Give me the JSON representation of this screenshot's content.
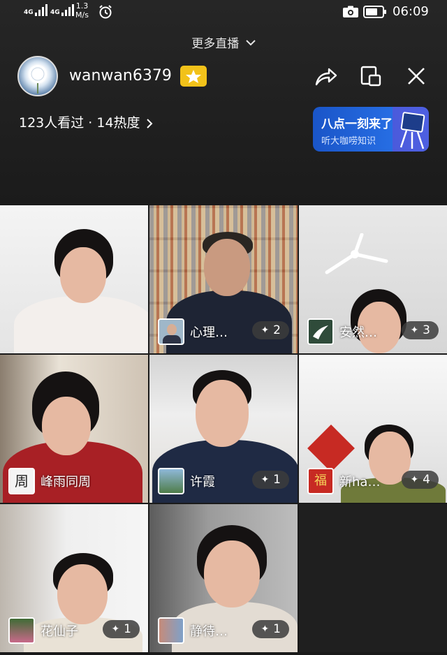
{
  "status_bar": {
    "sim1": "4G",
    "sim2": "4G",
    "net_speed_value": "1.3",
    "net_speed_unit": "M/s",
    "time": "06:09",
    "icons": [
      "signal-icon",
      "alarm-icon",
      "camera-icon",
      "battery-icon"
    ]
  },
  "header": {
    "more_live": "更多直播",
    "username": "wanwan6379",
    "stats": "123人看过 · 14热度",
    "icons": [
      "share-icon",
      "window-icon",
      "close-icon"
    ]
  },
  "promo": {
    "title": "八点一刻来了",
    "subtitle": "听大咖唠知识",
    "color": "#2563d9"
  },
  "participants": [
    {
      "name": "",
      "plus": ""
    },
    {
      "name": "心理…",
      "plus": "2"
    },
    {
      "name": "安然…",
      "plus": "3"
    },
    {
      "name": "峰雨同周",
      "plus": "",
      "avatar_text": "周"
    },
    {
      "name": "许霞",
      "plus": "1"
    },
    {
      "name": "新ha…",
      "plus": "4",
      "avatar_text": "福"
    },
    {
      "name": "花仙子",
      "plus": "1"
    },
    {
      "name": "静待…",
      "plus": "1"
    }
  ],
  "plus_glyph": "✦"
}
